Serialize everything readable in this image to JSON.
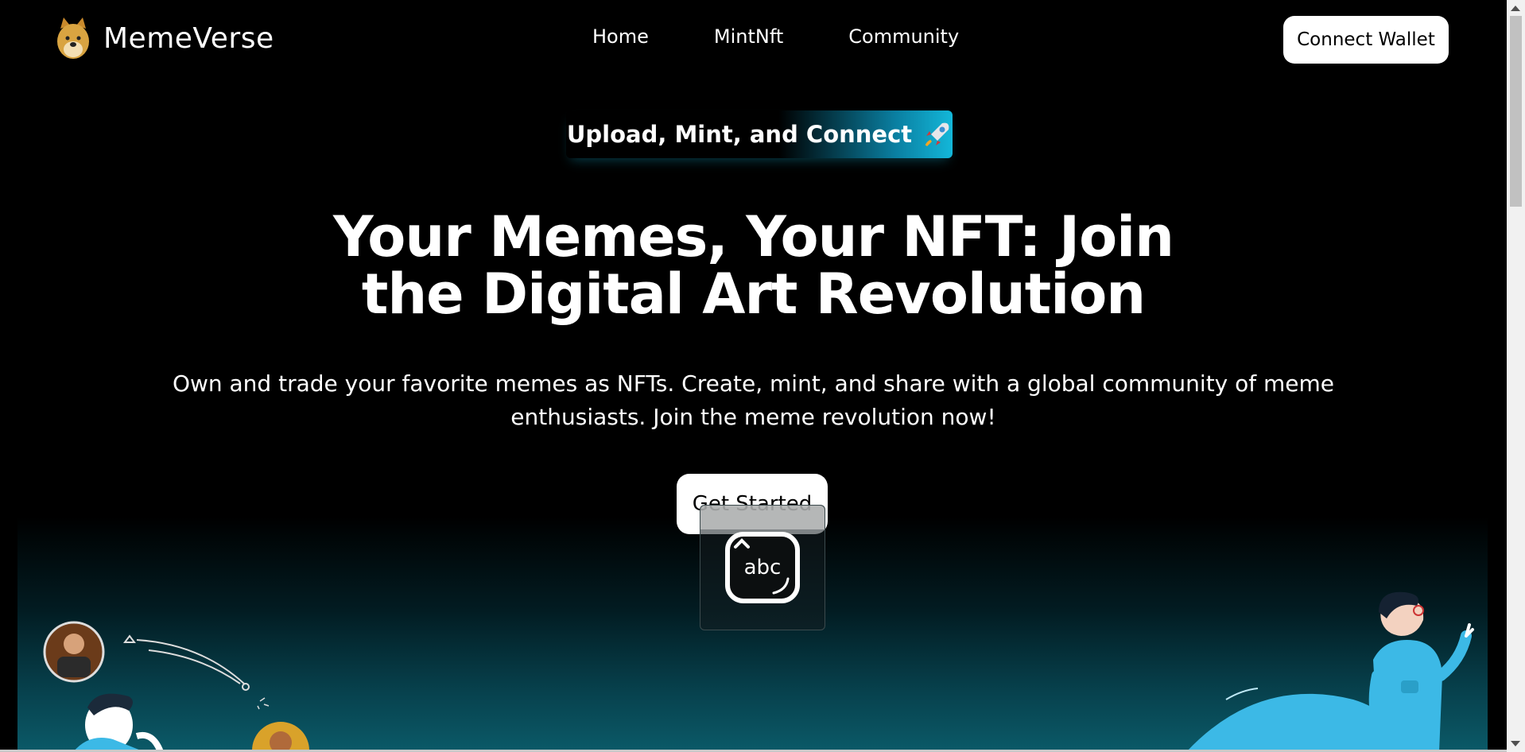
{
  "header": {
    "brand": "MemeVerse",
    "nav": [
      {
        "label": "Home"
      },
      {
        "label": "MintNft"
      },
      {
        "label": "Community"
      }
    ],
    "connect_label": "Connect Wallet"
  },
  "hero": {
    "tagline": "Upload, Mint, and Connect",
    "headline_line1": "Your Memes, Your NFT: Join",
    "headline_line2": "the Digital Art Revolution",
    "subtext": "Own and trade your favorite memes as NFTs. Create, mint, and share with a global community of meme enthusiasts. Join the meme revolution now!",
    "cta_label": "Get Started"
  },
  "keyboard_tile": {
    "label": "abc"
  },
  "icons": {
    "logo": "doge-icon",
    "tagline": "rocket-icon",
    "keyboard": "keyboard-icon"
  },
  "colors": {
    "background": "#000000",
    "accent": "#13b7d9",
    "band_bottom": "#0b5a68",
    "illustration_blue": "#3cb9e6"
  }
}
